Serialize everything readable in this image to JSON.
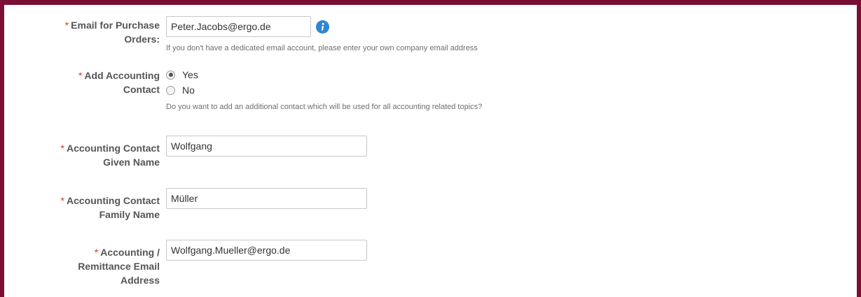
{
  "form": {
    "required_marker": "*",
    "email_po": {
      "label_line1": "Email for Purchase",
      "label_line2": "Orders:",
      "value": "Peter.Jacobs@ergo.de",
      "hint": "If you don't have a dedicated email account, please enter your own company email address",
      "icon": "info-icon"
    },
    "add_accounting_contact": {
      "label_line1": "Add Accounting",
      "label_line2": "Contact",
      "options": [
        {
          "label": "Yes",
          "selected": true
        },
        {
          "label": "No",
          "selected": false
        }
      ],
      "hint": "Do you want to add an additional contact which will be used for all accounting related topics?"
    },
    "given_name": {
      "label_line1": "Accounting Contact",
      "label_line2": "Given Name",
      "value": "Wolfgang"
    },
    "family_name": {
      "label_line1": "Accounting Contact",
      "label_line2": "Family Name",
      "value": "Müller"
    },
    "remittance_email": {
      "label_line1": "Accounting /",
      "label_line2": "Remittance Email",
      "label_line3": "Address",
      "value": "Wolfgang.Mueller@ergo.de"
    }
  },
  "colors": {
    "frame_border": "#7a0f36",
    "required_marker": "#e0331f",
    "info_icon": "#2f86d4"
  }
}
